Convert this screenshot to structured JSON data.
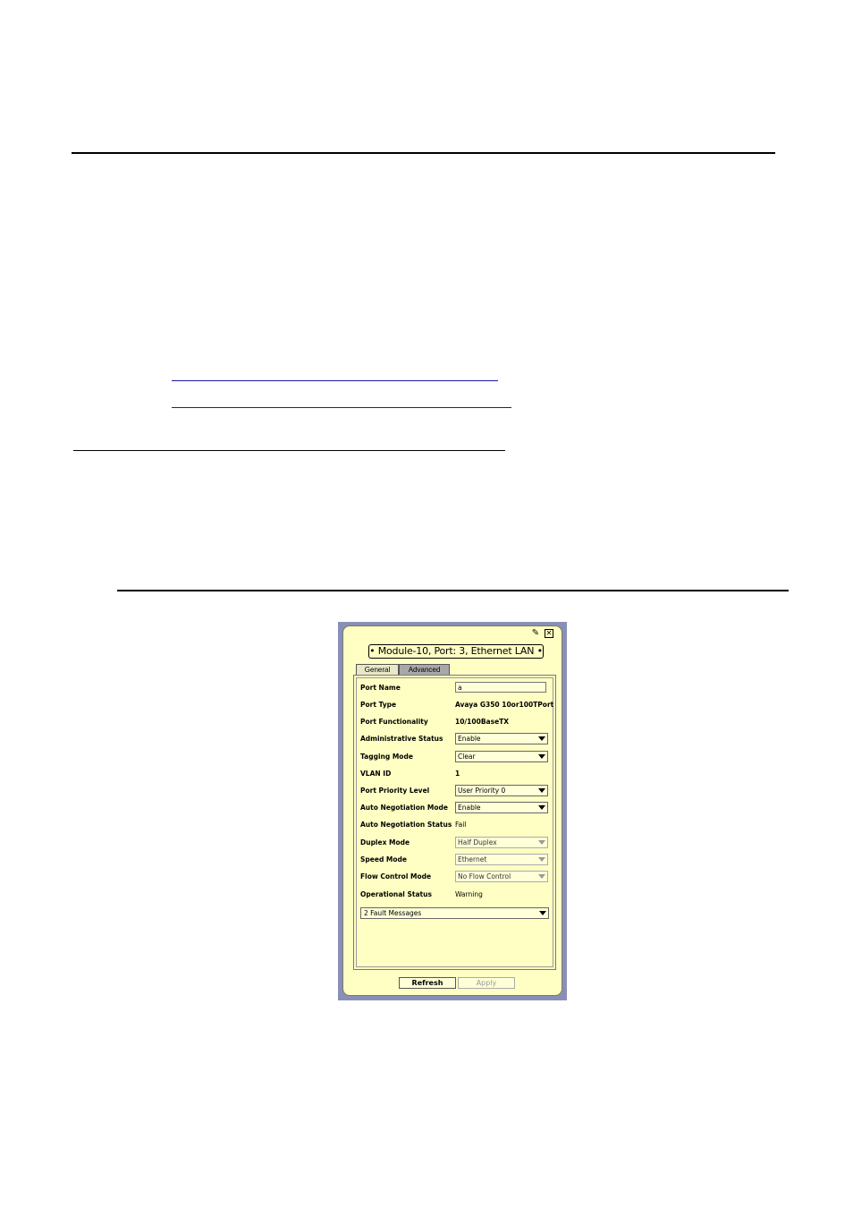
{
  "window": {
    "title": "• Module-10, Port: 3, Ethernet LAN •"
  },
  "tabs": [
    {
      "label": "General"
    },
    {
      "label": "Advanced"
    }
  ],
  "fields": {
    "port_name": {
      "label": "Port Name",
      "value": "a"
    },
    "port_type": {
      "label": "Port Type",
      "value": "Avaya G350 10or100TPort"
    },
    "port_functionality": {
      "label": "Port Functionality",
      "value": "10/100BaseTX"
    },
    "administrative_status": {
      "label": "Administrative Status",
      "value": "Enable"
    },
    "tagging_mode": {
      "label": "Tagging Mode",
      "value": "Clear"
    },
    "vlan_id": {
      "label": "VLAN ID",
      "value": "1"
    },
    "port_priority_level": {
      "label": "Port Priority Level",
      "value": "User Priority 0"
    },
    "auto_negotiation_mode": {
      "label": "Auto Negotiation Mode",
      "value": "Enable"
    },
    "auto_negotiation_status": {
      "label": "Auto Negotiation Status",
      "value": "Fail"
    },
    "duplex_mode": {
      "label": "Duplex Mode",
      "value": "Half Duplex"
    },
    "speed_mode": {
      "label": "Speed Mode",
      "value": "Ethernet"
    },
    "flow_control_mode": {
      "label": "Flow Control Mode",
      "value": "No Flow Control"
    },
    "operational_status": {
      "label": "Operational Status",
      "value": "Warning"
    }
  },
  "fault_messages": "2 Fault Messages",
  "buttons": {
    "refresh": "Refresh",
    "apply": "Apply"
  },
  "colors": {
    "panel_background": "#ffffc4",
    "panel_frame": "#8a8fb8",
    "selected_tab": "#a8a8a8"
  }
}
